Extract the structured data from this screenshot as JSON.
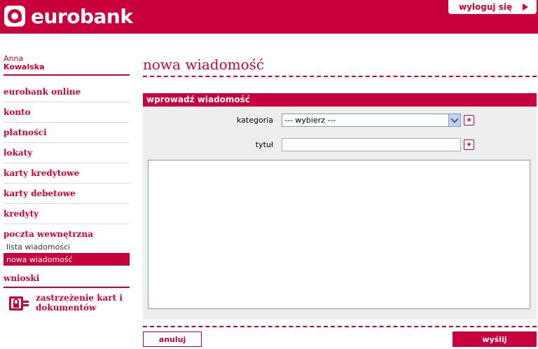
{
  "brand": {
    "name": "eurobank",
    "color": "#c8003c"
  },
  "header": {
    "logout_label": "wyloguj się",
    "logout_icon": "play-arrow-icon"
  },
  "user": {
    "first_name": "Anna",
    "last_name": "Kowalska"
  },
  "sidebar": {
    "items": [
      {
        "label": "eurobank online"
      },
      {
        "label": "konto"
      },
      {
        "label": "płatności"
      },
      {
        "label": "lokaty"
      },
      {
        "label": "karty kredytowe"
      },
      {
        "label": "karty debetowe"
      },
      {
        "label": "kredyty"
      },
      {
        "label": "poczta wewnętrzna"
      }
    ],
    "sub_items": [
      {
        "label": "lista wiadomości",
        "active": false
      },
      {
        "label": "nowa wiadomość",
        "active": true
      }
    ],
    "requests_label": "wnioski",
    "block_cards": {
      "line1": "zastrzeżenie kart i",
      "line2": "dokumentów",
      "icon": "lock-icon"
    }
  },
  "main": {
    "title": "nowa wiadomość",
    "section_title": "wprowadź wiadomość",
    "form": {
      "category_label": "kategoria",
      "category_value": "--- wybierz ---",
      "title_label": "tytuł",
      "title_value": "",
      "message_value": "",
      "required_mark": "*"
    },
    "buttons": {
      "cancel": "anuluj",
      "send": "wyślij"
    }
  }
}
